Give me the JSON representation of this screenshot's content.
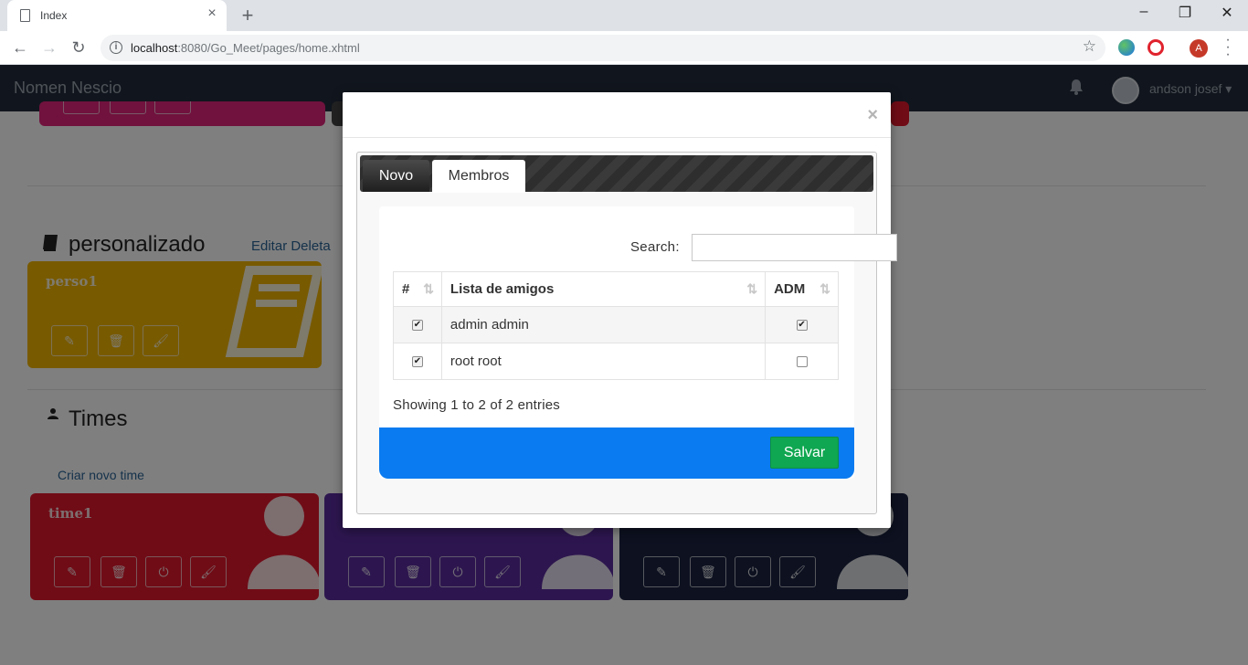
{
  "browser": {
    "tab_title": "Index",
    "tab_close": "×",
    "new_tab": "+",
    "url_host": "localhost",
    "url_rest": ":8080/Go_Meet/pages/home.xhtml",
    "profile_initial": "A",
    "window_controls": [
      "–",
      "❐",
      "✕"
    ]
  },
  "app": {
    "brand": "Nomen Nescio",
    "user_name": "andson josef",
    "user_caret": "▾"
  },
  "sections": {
    "custom": {
      "title": "personalizado",
      "actions": "Editar Deleta"
    },
    "teams": {
      "title": "Times",
      "create_link": "Criar novo time"
    }
  },
  "cards": {
    "custom": [
      {
        "title": "perso1",
        "color": "#f0b400"
      }
    ],
    "teams": [
      {
        "title": "time1",
        "color": "#e0182c"
      },
      {
        "title": "",
        "color": "#5b2c9e"
      },
      {
        "title": "",
        "color": "#1a2340"
      }
    ],
    "top_colors": [
      "#e0247a",
      "#444444",
      "#e0182c"
    ]
  },
  "modal": {
    "close": "×",
    "tabs": [
      {
        "label": "Novo",
        "active": false
      },
      {
        "label": "Membros",
        "active": true
      }
    ],
    "search_label": "Search:",
    "search_value": "",
    "table": {
      "headers": [
        "#",
        "Lista de amigos",
        "ADM"
      ],
      "rows": [
        {
          "selected": true,
          "name": "admin admin",
          "adm": true
        },
        {
          "selected": true,
          "name": "root root",
          "adm": false
        }
      ]
    },
    "info": "Showing 1 to 2 of 2 entries",
    "save_label": "Salvar",
    "colors": {
      "footer": "#0a7bf0",
      "save": "#0fa751"
    }
  }
}
